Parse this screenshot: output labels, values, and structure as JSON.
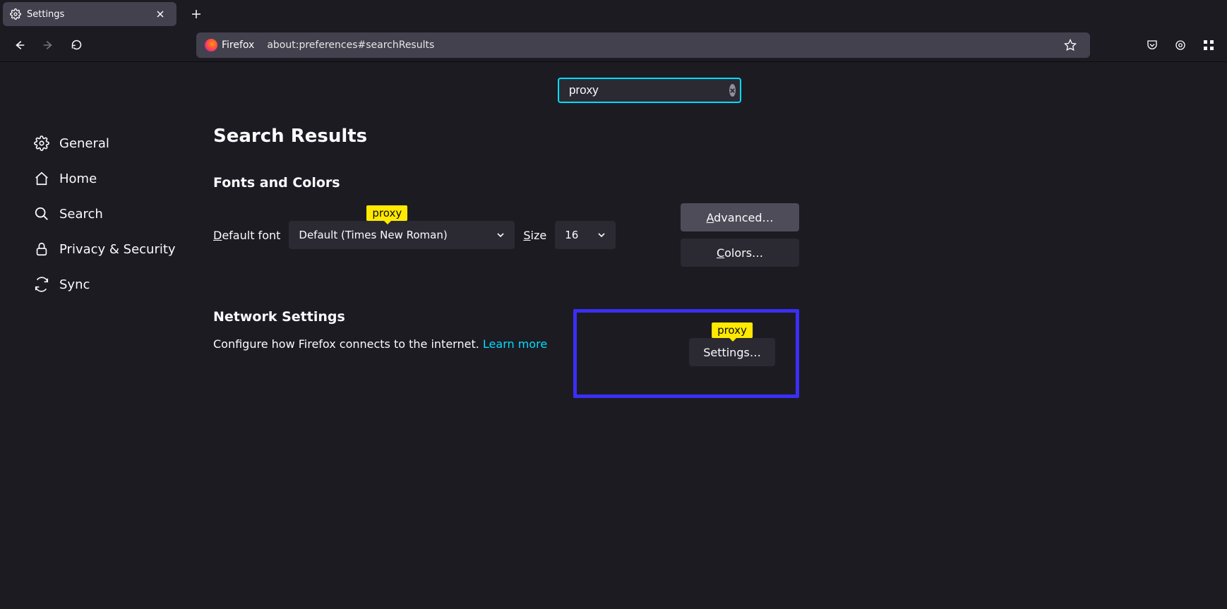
{
  "tab": {
    "title": "Settings"
  },
  "url": {
    "identity_label": "Firefox",
    "value": "about:preferences#searchResults"
  },
  "search": {
    "value": "proxy"
  },
  "sidebar": {
    "items": [
      {
        "label": "General"
      },
      {
        "label": "Home"
      },
      {
        "label": "Search"
      },
      {
        "label": "Privacy & Security"
      },
      {
        "label": "Sync"
      }
    ]
  },
  "content": {
    "heading": "Search Results",
    "fonts": {
      "title": "Fonts and Colors",
      "default_label_pre": "D",
      "default_label_rest": "efault font",
      "font_value": "Default (Times New Roman)",
      "size_label_pre": "S",
      "size_label_rest": "ize",
      "size_value": "16",
      "advanced_pre": "A",
      "advanced_rest": "dvanced…",
      "colors_pre": "C",
      "colors_rest": "olors…",
      "tag": "proxy"
    },
    "network": {
      "title": "Network Settings",
      "desc": "Configure how Firefox connects to the internet. ",
      "learn": "Learn more",
      "settings_btn": "Settings…",
      "tag": "proxy"
    }
  }
}
